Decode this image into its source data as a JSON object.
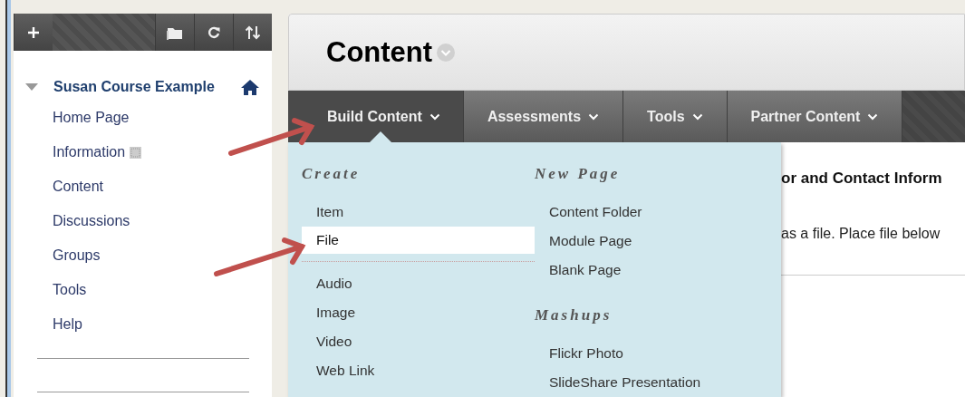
{
  "sidebar": {
    "course": {
      "title": "Susan Course Example",
      "expanded": true
    },
    "items": [
      {
        "label": "Home Page",
        "marked": false
      },
      {
        "label": "Information",
        "marked": true
      },
      {
        "label": "Content",
        "marked": false
      },
      {
        "label": "Discussions",
        "marked": false
      },
      {
        "label": "Groups",
        "marked": false
      },
      {
        "label": "Tools",
        "marked": false
      },
      {
        "label": "Help",
        "marked": false
      }
    ]
  },
  "page": {
    "title": "Content"
  },
  "nav": [
    {
      "label": "Build Content",
      "selected": true
    },
    {
      "label": "Assessments",
      "selected": false
    },
    {
      "label": "Tools",
      "selected": false
    },
    {
      "label": "Partner Content",
      "selected": false
    }
  ],
  "content": {
    "heading": "or and Contact Inform",
    "text": "as a file. Place file below"
  },
  "dropdown": {
    "columns": [
      {
        "sections": [
          {
            "heading": "Create",
            "groups": [
              [
                {
                  "label": "Item",
                  "selected": false
                },
                {
                  "label": "File",
                  "selected": true
                }
              ],
              [
                {
                  "label": "Audio",
                  "selected": false
                },
                {
                  "label": "Image",
                  "selected": false
                },
                {
                  "label": "Video",
                  "selected": false
                },
                {
                  "label": "Web Link",
                  "selected": false
                }
              ]
            ]
          }
        ]
      },
      {
        "sections": [
          {
            "heading": "New Page",
            "groups": [
              [
                {
                  "label": "Content Folder",
                  "selected": false
                },
                {
                  "label": "Module Page",
                  "selected": false
                },
                {
                  "label": "Blank Page",
                  "selected": false
                }
              ]
            ]
          },
          {
            "heading": "Mashups",
            "groups": [
              [
                {
                  "label": "Flickr Photo",
                  "selected": false
                },
                {
                  "label": "SlideShare Presentation",
                  "selected": false
                }
              ]
            ]
          }
        ]
      }
    ]
  }
}
